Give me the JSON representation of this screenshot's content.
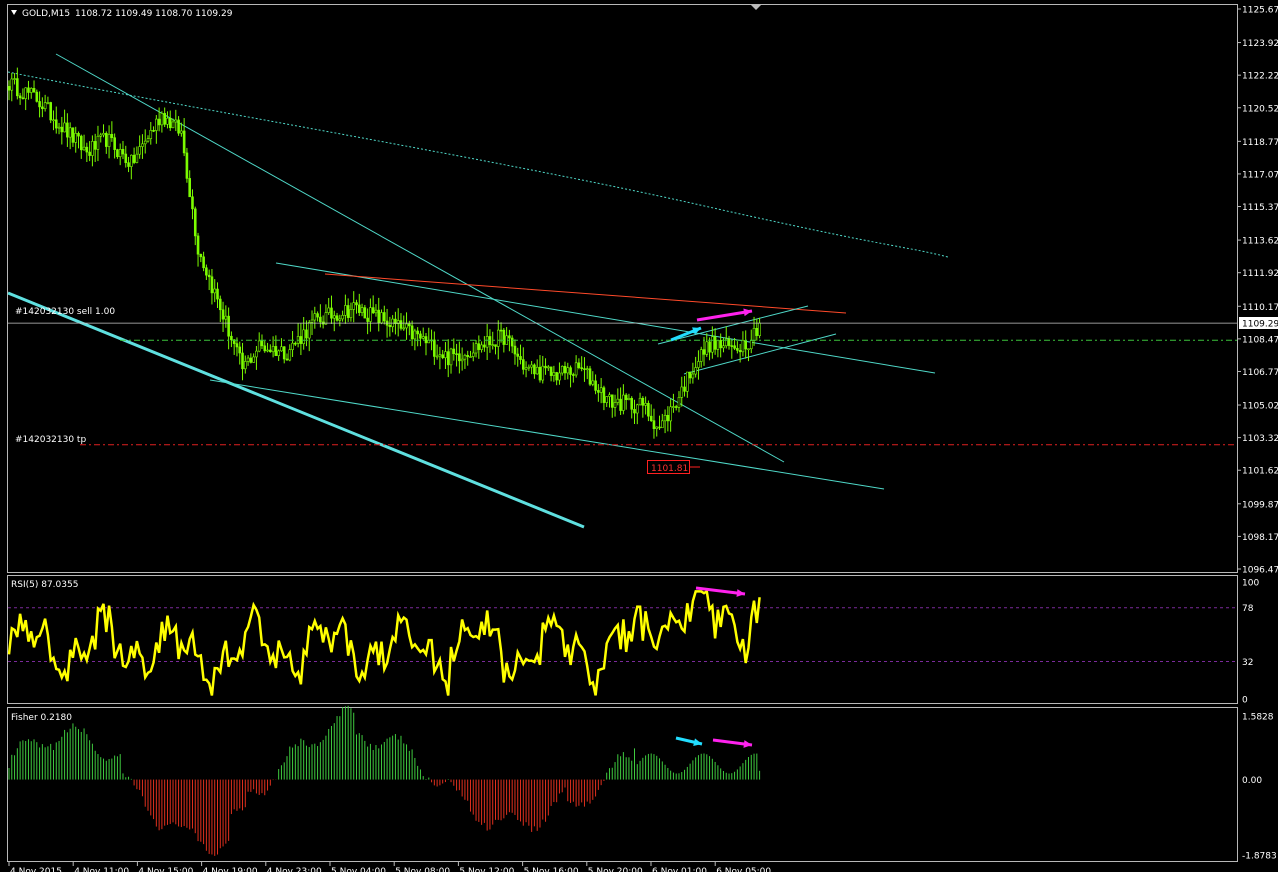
{
  "header": {
    "title": "GOLD,M15",
    "ohlc": "1108.72 1109.49 1108.70 1109.29"
  },
  "price_pane": {
    "y_ticks": [
      "1125.67",
      "1123.92",
      "1122.22",
      "1120.52",
      "1118.77",
      "1117.07",
      "1115.37",
      "1113.62",
      "1111.92",
      "1110.17",
      "1108.47",
      "1106.77",
      "1105.02",
      "1103.32",
      "1101.62",
      "1099.87",
      "1098.17",
      "1096.47"
    ],
    "current_price": "1109.29",
    "order_label": "#142032130 sell 1.00",
    "tp_label": "#142032130 tp",
    "tp_box": "1101.81",
    "order_price": 1108.4,
    "tp_price": 1102.95
  },
  "rsi_pane": {
    "title": "RSI(5) 87.0355",
    "levels": [
      "100",
      "78",
      "32",
      "0"
    ]
  },
  "fisher_pane": {
    "title": "Fisher 0.2180",
    "levels": [
      "1.5828",
      "0.00",
      "-1.8783"
    ]
  },
  "x_ticks": [
    "4 Nov 2015",
    "4 Nov 11:00",
    "4 Nov 15:00",
    "4 Nov 19:00",
    "4 Nov 23:00",
    "5 Nov 04:00",
    "5 Nov 08:00",
    "5 Nov 12:00",
    "5 Nov 16:00",
    "5 Nov 20:00",
    "6 Nov 01:00",
    "6 Nov 05:00"
  ],
  "colors": {
    "bull": "#7CFC00",
    "trend": "#4FD8C8",
    "resistance": "#FF4A2A",
    "rsi": "#FFFF00",
    "fisher_up": "#3FCB3F",
    "fisher_down": "#E0301E",
    "arrow_magenta": "#FF22EE",
    "arrow_cyan": "#22DDFF"
  },
  "chart_data": [
    {
      "type": "candlestick",
      "title": "GOLD,M15",
      "ylim": [
        1096.47,
        1125.67
      ],
      "close_waypoints": [
        [
          0,
          1121.8
        ],
        [
          10,
          1121.0
        ],
        [
          20,
          1119.4
        ],
        [
          28,
          1118.2
        ],
        [
          35,
          1118.9
        ],
        [
          44,
          1117.6
        ],
        [
          55,
          1120.2
        ],
        [
          62,
          1119.2
        ],
        [
          68,
          1113.2
        ],
        [
          78,
          1109.3
        ],
        [
          84,
          1106.9
        ],
        [
          90,
          1108.1
        ],
        [
          100,
          1107.8
        ],
        [
          110,
          1109.4
        ],
        [
          124,
          1110.1
        ],
        [
          134,
          1109.5
        ],
        [
          148,
          1108.5
        ],
        [
          158,
          1107.5
        ],
        [
          166,
          1107.9
        ],
        [
          178,
          1108.6
        ],
        [
          186,
          1106.9
        ],
        [
          196,
          1106.6
        ],
        [
          206,
          1106.9
        ],
        [
          216,
          1105.2
        ],
        [
          228,
          1105.0
        ],
        [
          234,
          1103.8
        ],
        [
          240,
          1105.2
        ],
        [
          246,
          1107.0
        ],
        [
          252,
          1108.2
        ],
        [
          260,
          1108.0
        ],
        [
          266,
          1108.4
        ],
        [
          270,
          1109.29
        ]
      ]
    },
    {
      "type": "line",
      "title": "RSI(5) 87.0355",
      "ylim": [
        0,
        100
      ],
      "last_value": 87.0355
    },
    {
      "type": "bar",
      "title": "Fisher 0.2180",
      "ylim": [
        -1.8783,
        1.5828
      ],
      "last_value": 0.218
    }
  ]
}
